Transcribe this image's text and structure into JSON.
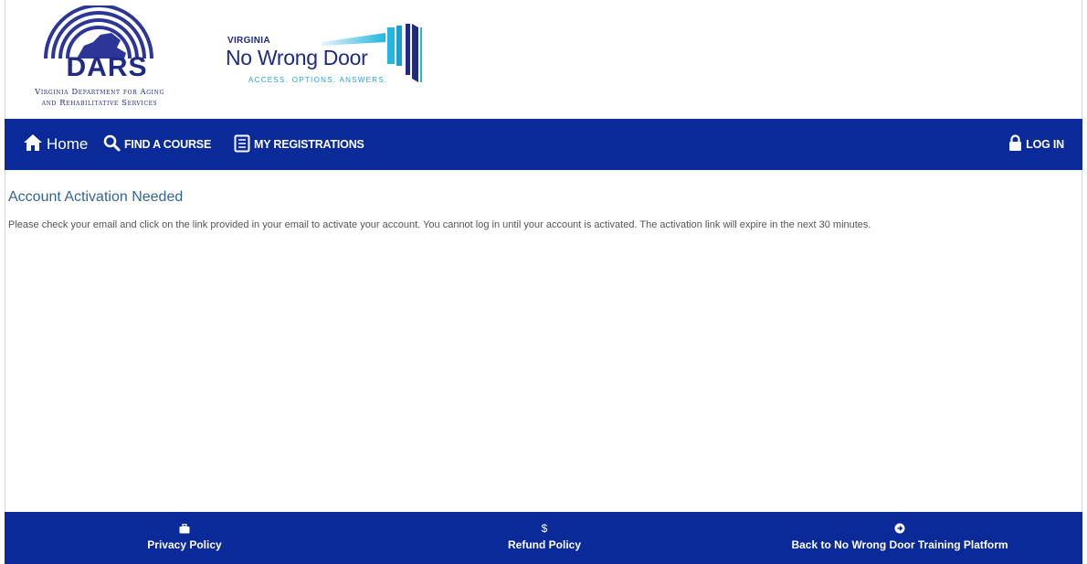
{
  "header": {
    "dars_logo": {
      "abbr": "DARS",
      "subtitle_line1": "Virginia Department for Aging",
      "subtitle_line2": "and Rehabilitative Services"
    },
    "nwd_logo": {
      "state": "VIRGINIA",
      "title": "No Wrong Door",
      "tagline": "ACCESS. OPTIONS. ANSWERS."
    }
  },
  "nav": {
    "background": "#0b2a99",
    "home_label": "Home",
    "find_label": "FIND A COURSE",
    "registrations_label": "MY REGISTRATIONS",
    "login_label": "LOG IN"
  },
  "main": {
    "title": "Account Activation Needed",
    "message": "Please check your email and click on the link provided in your email to activate your account. You cannot log in until your account is activated. The activation link will expire in the next 30 minutes."
  },
  "footer": {
    "links": [
      {
        "label": "Privacy Policy",
        "icon": "briefcase-icon"
      },
      {
        "label": "Refund Policy",
        "icon": "dollar-icon",
        "glyph": "$"
      },
      {
        "label": "Back to No Wrong Door Training Platform",
        "icon": "circle-arrow-right-icon"
      }
    ]
  },
  "colors": {
    "brand_navy": "#1f2a86",
    "nav_blue": "#0b2a99",
    "title_blue": "#33659a",
    "tagline_cyan": "#2a9fd6"
  }
}
